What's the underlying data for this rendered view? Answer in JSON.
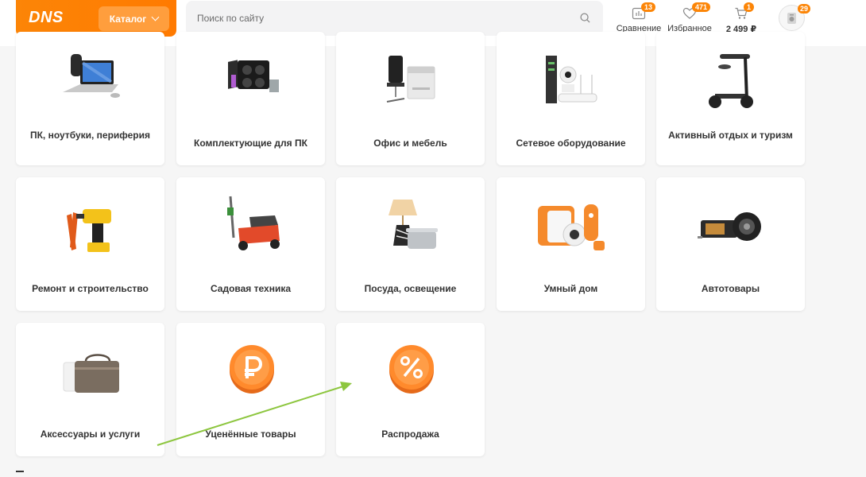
{
  "header": {
    "logo_text": "DNS",
    "catalog_label": "Каталог",
    "search_placeholder": "Поиск по сайту",
    "compare": {
      "label": "Сравнение",
      "count": "13"
    },
    "favorites": {
      "label": "Избранное",
      "count": "471"
    },
    "cart": {
      "label": "2 499 ₽",
      "count": "1"
    },
    "profile": {
      "count": "29"
    }
  },
  "categories": [
    {
      "label": "ПК, ноутбуки, периферия"
    },
    {
      "label": "Комплектующие для ПК"
    },
    {
      "label": "Офис и мебель"
    },
    {
      "label": "Сетевое оборудование"
    },
    {
      "label": "Активный отдых и туризм"
    },
    {
      "label": "Ремонт и строительство"
    },
    {
      "label": "Садовая техника"
    },
    {
      "label": "Посуда, освещение"
    },
    {
      "label": "Умный дом"
    },
    {
      "label": "Автотовары"
    },
    {
      "label": "Аксессуары и услуги"
    },
    {
      "label": "Уценённые товары"
    },
    {
      "label": "Распродажа"
    }
  ],
  "colors": {
    "accent": "#fc8507",
    "annotation_arrow": "#8dc63f"
  }
}
